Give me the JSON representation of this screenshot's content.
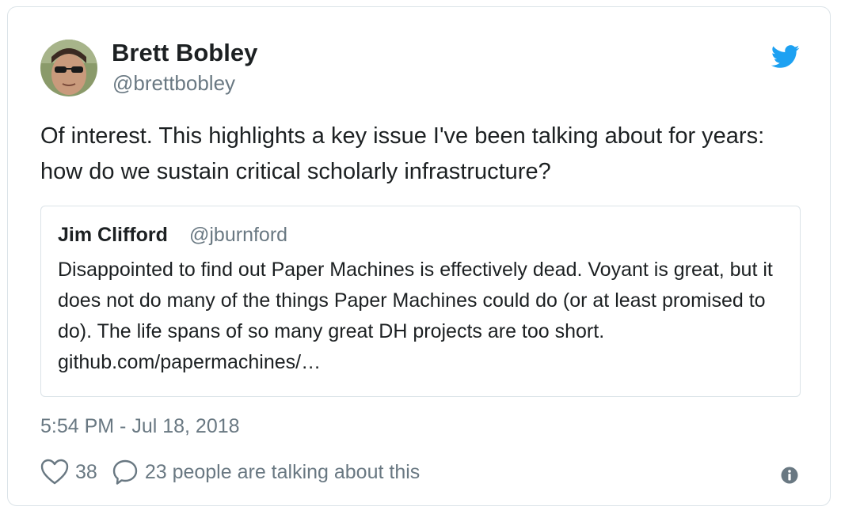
{
  "tweet": {
    "author_name": "Brett Bobley",
    "author_handle": "@brettbobley",
    "text": "Of interest. This highlights a key issue I've been talking about for years: how do we sustain critical scholarly infrastructure?",
    "timestamp": "5:54 PM - Jul 18, 2018"
  },
  "quoted_tweet": {
    "author_name": "Jim Clifford",
    "author_handle": "@jburnford",
    "text": "Disappointed to find out Paper Machines is effectively dead. Voyant is great, but it does not do many of the things Paper Machines could do (or at least promised to do). The life spans of so many great DH projects are too short. github.com/papermachines/…"
  },
  "actions": {
    "like_count": "38",
    "talking_text": "23 people are talking about this"
  },
  "icons": {
    "brand": "twitter-bird-icon",
    "like": "heart-icon",
    "reply": "speech-bubble-icon",
    "info": "info-icon"
  },
  "colors": {
    "brand_blue": "#1da1f2",
    "text": "#1c2022",
    "muted": "#697882",
    "border": "#dbe3e8"
  }
}
